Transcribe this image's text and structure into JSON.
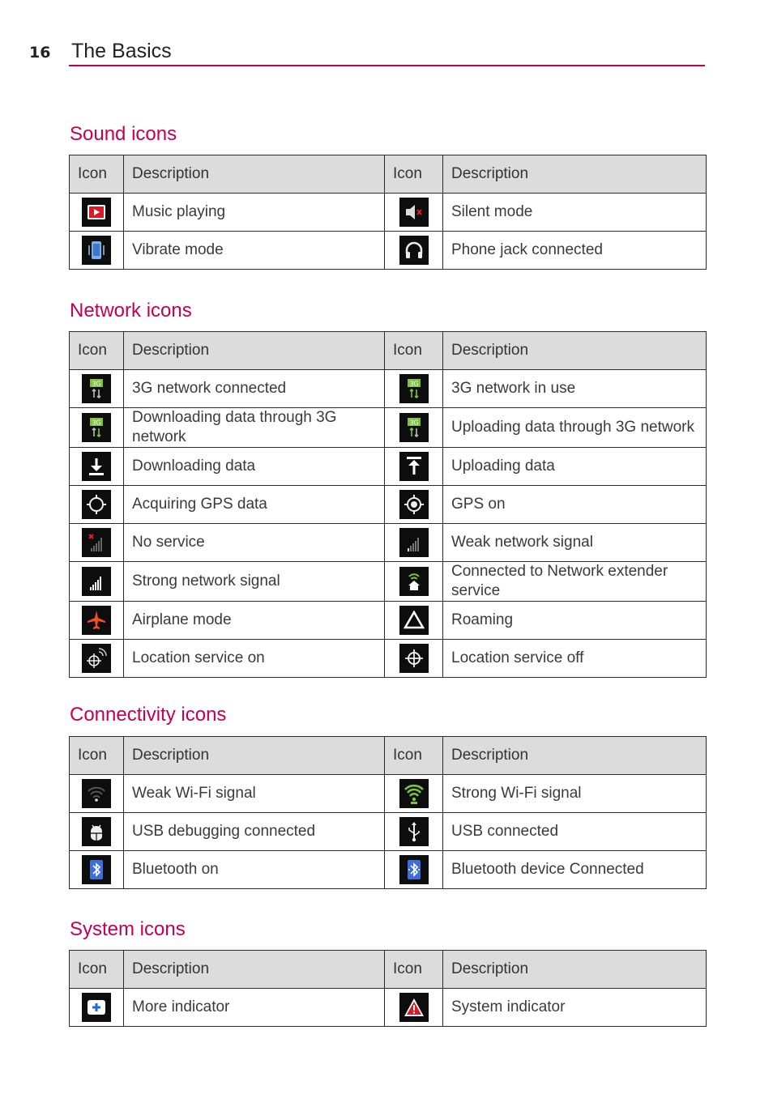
{
  "header": {
    "page_number": "16",
    "chapter_title": "The Basics"
  },
  "colors": {
    "accent": "#c6004e",
    "header_fill": "#dcdcdc",
    "border": "#2a2a2a"
  },
  "sections": [
    {
      "title": "Sound icons",
      "headers": [
        "Icon",
        "Description",
        "Icon",
        "Description"
      ],
      "rows": [
        [
          {
            "icon": "music-playing-icon",
            "desc": "Music playing"
          },
          {
            "icon": "silent-mode-icon",
            "desc": "Silent mode"
          }
        ],
        [
          {
            "icon": "vibrate-mode-icon",
            "desc": "Vibrate mode"
          },
          {
            "icon": "headphones-icon",
            "desc": "Phone jack connected"
          }
        ]
      ]
    },
    {
      "title": "Network icons",
      "headers": [
        "Icon",
        "Description",
        "Icon",
        "Description"
      ],
      "rows": [
        [
          {
            "icon": "3g-connected-icon",
            "desc": "3G network connected"
          },
          {
            "icon": "3g-in-use-icon",
            "desc": "3G network in use"
          }
        ],
        [
          {
            "icon": "3g-download-icon",
            "desc": "Downloading data through 3G network"
          },
          {
            "icon": "3g-upload-icon",
            "desc": "Uploading data through 3G network"
          }
        ],
        [
          {
            "icon": "download-icon",
            "desc": "Downloading data"
          },
          {
            "icon": "upload-icon",
            "desc": "Uploading data"
          }
        ],
        [
          {
            "icon": "gps-acquiring-icon",
            "desc": "Acquiring GPS data"
          },
          {
            "icon": "gps-on-icon",
            "desc": "GPS on"
          }
        ],
        [
          {
            "icon": "no-service-icon",
            "desc": "No service"
          },
          {
            "icon": "weak-signal-icon",
            "desc": "Weak network signal"
          }
        ],
        [
          {
            "icon": "strong-signal-icon",
            "desc": "Strong network signal"
          },
          {
            "icon": "network-extender-icon",
            "desc": "Connected to Network extender service"
          }
        ],
        [
          {
            "icon": "airplane-mode-icon",
            "desc": "Airplane mode"
          },
          {
            "icon": "roaming-icon",
            "desc": "Roaming"
          }
        ],
        [
          {
            "icon": "location-on-icon",
            "desc": "Location service on"
          },
          {
            "icon": "location-off-icon",
            "desc": "Location service off"
          }
        ]
      ]
    },
    {
      "title": "Connectivity icons",
      "headers": [
        "Icon",
        "Description",
        "Icon",
        "Description"
      ],
      "rows": [
        [
          {
            "icon": "wifi-weak-icon",
            "desc": "Weak Wi-Fi signal"
          },
          {
            "icon": "wifi-strong-icon",
            "desc": "Strong Wi-Fi signal"
          }
        ],
        [
          {
            "icon": "usb-debugging-icon",
            "desc": "USB debugging connected"
          },
          {
            "icon": "usb-icon",
            "desc": "USB connected"
          }
        ],
        [
          {
            "icon": "bluetooth-icon",
            "desc": "Bluetooth on"
          },
          {
            "icon": "bluetooth-connected-icon",
            "desc": "Bluetooth device Connected"
          }
        ]
      ]
    },
    {
      "title": "System icons",
      "headers": [
        "Icon",
        "Description",
        "Icon",
        "Description"
      ],
      "rows": [
        [
          {
            "icon": "more-indicator-icon",
            "desc": "More indicator"
          },
          {
            "icon": "system-warning-icon",
            "desc": "System indicator"
          }
        ]
      ]
    }
  ]
}
